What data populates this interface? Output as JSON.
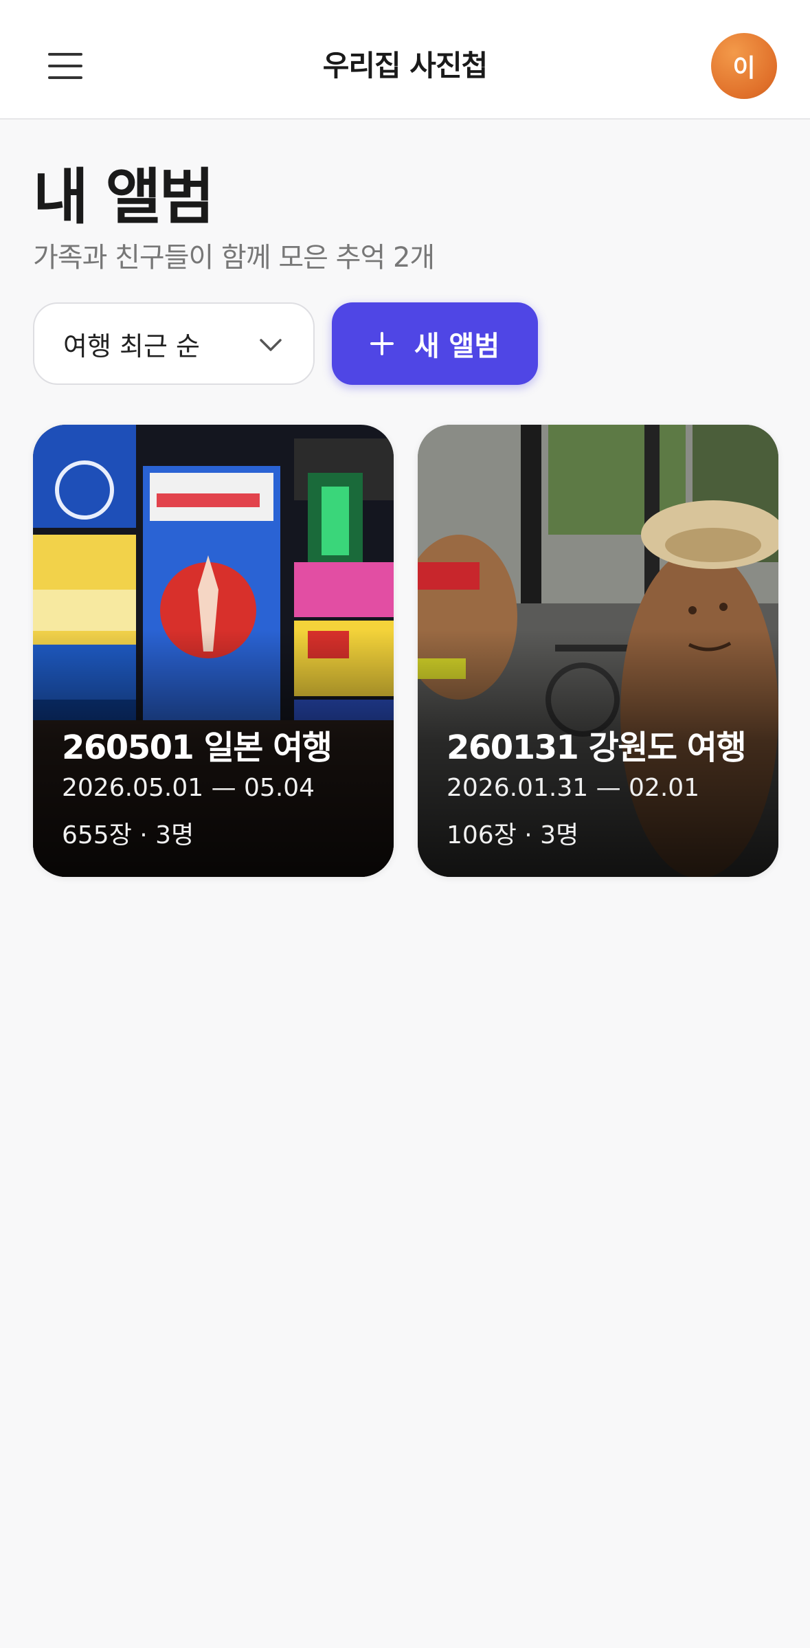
{
  "header": {
    "title": "우리집 사진첩",
    "avatar_initial": "이",
    "menu_icon": "hamburger-menu-icon"
  },
  "main": {
    "title": "내 앨범",
    "subtitle": "가족과 친구들이 함께 모은 추억 2개",
    "sort": {
      "selected": "여행 최근 순",
      "icon": "chevron-down-icon"
    },
    "new_album_label": "새 앨범",
    "new_album_icon": "plus-icon"
  },
  "albums": [
    {
      "title": "260501 일본 여행",
      "dates": "2026.05.01 — 05.04",
      "meta": "655장 · 3명"
    },
    {
      "title": "260131 강원도 여행",
      "dates": "2026.01.31 — 02.01",
      "meta": "106장 · 3명"
    }
  ],
  "colors": {
    "accent": "#4f46e5",
    "avatar": "#e97a35",
    "background": "#f8f8f9"
  }
}
